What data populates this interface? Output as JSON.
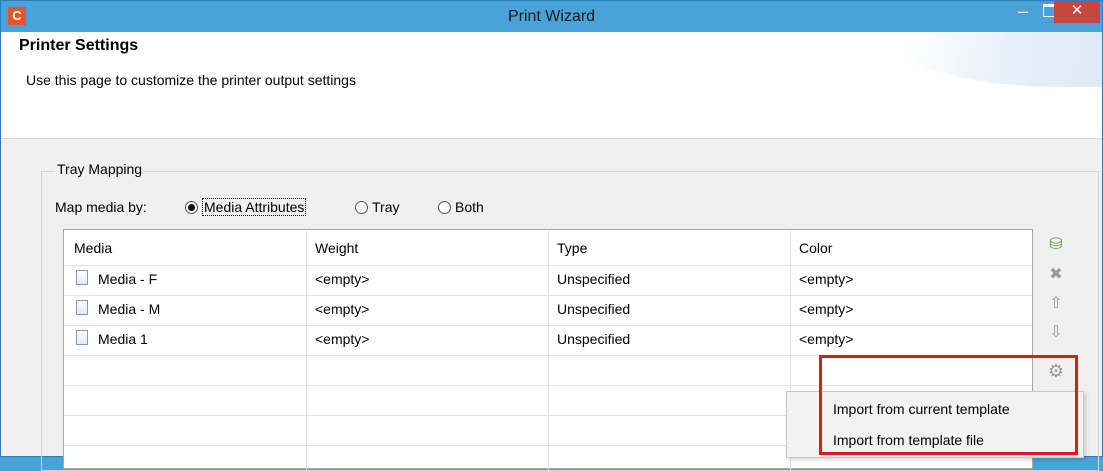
{
  "window": {
    "title": "Print Wizard",
    "app_icon": "C",
    "minimize_glyph": "–",
    "close_glyph": "✕"
  },
  "header": {
    "title": "Printer Settings",
    "description": "Use this page to customize the printer output settings"
  },
  "tray_mapping": {
    "group_label": "Tray Mapping",
    "map_by_label": "Map media by:",
    "options": [
      "Media Attributes",
      "Tray",
      "Both"
    ],
    "selected": "Media Attributes"
  },
  "table": {
    "columns": [
      "Media",
      "Weight",
      "Type",
      "Color"
    ],
    "rows": [
      [
        "Media - F",
        "<empty>",
        "Unspecified",
        "<empty>"
      ],
      [
        "Media - M",
        "<empty>",
        "Unspecified",
        "<empty>"
      ],
      [
        "Media 1",
        "<empty>",
        "Unspecified",
        "<empty>"
      ]
    ]
  },
  "side_toolbar": {
    "icons": [
      "add-media-icon",
      "delete-icon",
      "move-up-icon",
      "move-down-icon",
      "gear-icon"
    ],
    "glyphs": [
      "⛁",
      "✖",
      "⇧",
      "⇩",
      "⚙"
    ]
  },
  "context_menu": {
    "items": [
      "Import from current template",
      "Import from template file"
    ]
  },
  "colors": {
    "titlebar": "#4aa3d8",
    "close_button": "#c7463f",
    "highlight": "#e8141e"
  }
}
